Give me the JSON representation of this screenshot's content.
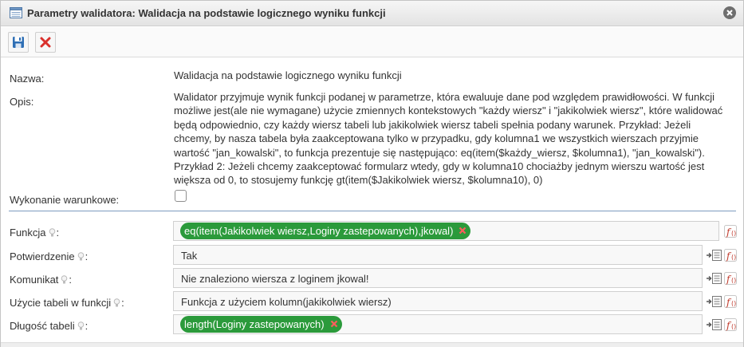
{
  "dialog": {
    "title": "Parametry walidatora: Walidacja na podstawie logicznego wyniku funkcji"
  },
  "form": {
    "nazwa_label": "Nazwa:",
    "nazwa_value": "Walidacja na podstawie logicznego wyniku funkcji",
    "opis_label": "Opis:",
    "opis_lines": [
      "Walidator przyjmuje wynik funkcji podanej w parametrze, która ewaluuje dane pod względem prawidłowości. W funkcji",
      "możliwe jest(ale nie wymagane) użycie zmiennych kontekstowych \"każdy wiersz\" i \"jakikolwiek wiersz\", które walidować",
      "będą odpowiednio, czy każdy wiersz tabeli lub jakikolwiek wiersz tabeli spełnia podany warunek. Przykład: Jeżeli",
      "chcemy, by nasza tabela była zaakceptowana tylko w przypadku, gdy kolumna1 we wszystkich wierszach przyjmie",
      "wartość \"jan_kowalski\", to funkcja prezentuje się następująco: eq(item($każdy_wiersz, $kolumna1), \"jan_kowalski\").",
      "Przykład 2: Jeżeli chcemy zaakceptować formularz wtedy, gdy w kolumna10 chociażby jednym wierszu wartość jest",
      "większa od 0, to stosujemy funkcję gt(item($Jakikolwiek wiersz, $kolumna10), 0)"
    ],
    "wykonanie_label": "Wykonanie warunkowe:",
    "wykonanie_checked": false
  },
  "params": [
    {
      "label": "Funkcja",
      "type": "tag",
      "value": "eq(item(Jakikolwiek wiersz,Loginy zastepowanych),jkowal)"
    },
    {
      "label": "Potwierdzenie",
      "type": "text",
      "value": "Tak"
    },
    {
      "label": "Komunikat",
      "type": "text",
      "value": "Nie znaleziono wiersza z loginem jkowal!"
    },
    {
      "label": "Użycie tabeli w funkcji",
      "type": "text",
      "value": "Funkcja z użyciem kolumn(jakikolwiek wiersz)"
    },
    {
      "label": "Długość tabeli",
      "type": "tag",
      "value": "length(Loginy zastepowanych)"
    }
  ],
  "param_suffix": ":",
  "colors": {
    "tag_green": "#2b9a3b",
    "separator_blue": "#7c9bbf",
    "cancel_red": "#d9302c",
    "save_blue": "#2f6fb5"
  },
  "icons": {
    "title": "window-icon",
    "close": "close-icon",
    "save": "save-icon",
    "cancel": "cancel-icon",
    "hint": "lightbulb-icon",
    "insert": "insert-variable-icon",
    "function": "function-icon",
    "tag_remove": "remove-tag-icon"
  }
}
